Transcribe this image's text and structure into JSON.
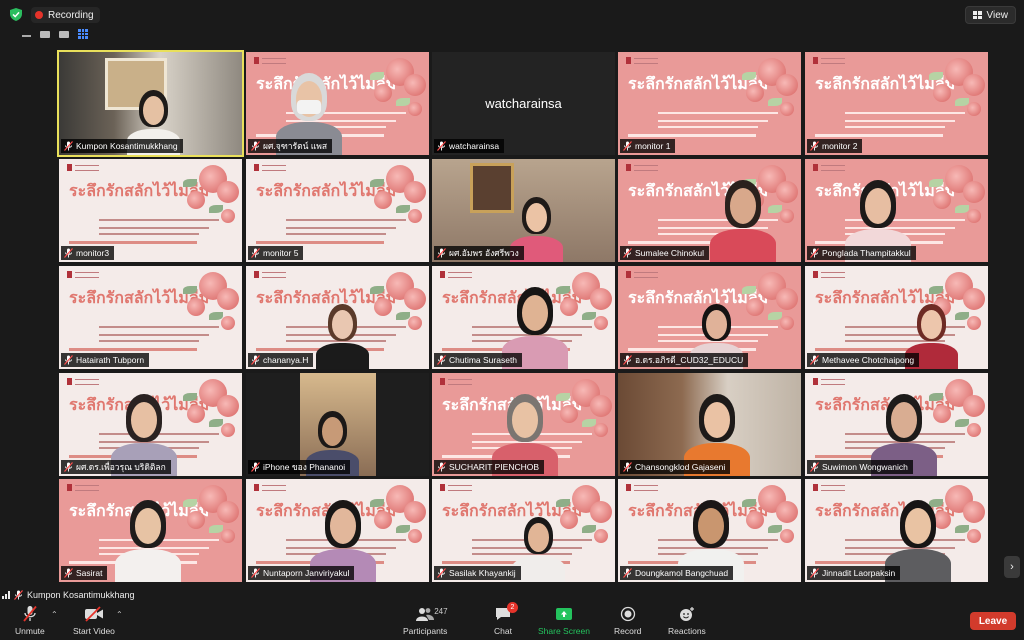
{
  "top": {
    "recording_label": "Recording",
    "view_label": "View"
  },
  "tiles": [
    {
      "name": "Kumpon Kosantimukkhang",
      "type": "camera"
    },
    {
      "name": "ผศ.จุฑารัตน์ แพส",
      "type": "slide-person"
    },
    {
      "name": "watcharainsa",
      "type": "name-only",
      "display_text": "watcharainsa"
    },
    {
      "name": "monitor 1",
      "type": "slide"
    },
    {
      "name": "monitor 2",
      "type": "slide"
    },
    {
      "name": "monitor3",
      "type": "slide"
    },
    {
      "name": "monitor 5",
      "type": "slide"
    },
    {
      "name": "ผศ.อัมพร อังศรีพวง",
      "type": "camera"
    },
    {
      "name": "Sumalee Chinokul",
      "type": "slide-person"
    },
    {
      "name": "Ponglada Thampitakkul",
      "type": "slide-person"
    },
    {
      "name": "Hatairath Tubporn",
      "type": "slide"
    },
    {
      "name": "chananya.H",
      "type": "slide-person"
    },
    {
      "name": "Chutima Suraseth",
      "type": "slide-person"
    },
    {
      "name": "อ.ดร.อภิรดี_CUD32_EDUCU",
      "type": "slide-person"
    },
    {
      "name": "Methavee Chotchaipong",
      "type": "slide-person"
    },
    {
      "name": "ผศ.ดร.เพื่อวรุณ บริดิติลก",
      "type": "slide-person"
    },
    {
      "name": "iPhone ของ Phananoi",
      "type": "camera"
    },
    {
      "name": "SUCHARIT PIENCHOB",
      "type": "slide-person"
    },
    {
      "name": "Chansongklod Gajaseni",
      "type": "camera"
    },
    {
      "name": "Suwimon Wongwanich",
      "type": "slide-person"
    },
    {
      "name": "Sasirat",
      "type": "slide-person"
    },
    {
      "name": "Nuntaporn Janviriyakul",
      "type": "slide-person"
    },
    {
      "name": "Sasilak Khayankij",
      "type": "slide-person"
    },
    {
      "name": "Doungkamol Bangchuad",
      "type": "slide-person"
    },
    {
      "name": "Jinnadit Laorpaksin",
      "type": "slide-person"
    }
  ],
  "slide": {
    "heading": "ระลึกรักสลักไว้ไม่ลืม"
  },
  "self": {
    "name": "Kumpon Kosantimukkhang"
  },
  "toolbar": {
    "unmute": "Unmute",
    "start_video": "Start Video",
    "participants": "Participants",
    "participants_count": "247",
    "chat": "Chat",
    "chat_badge": "2",
    "share_screen": "Share Screen",
    "record": "Record",
    "reactions": "Reactions",
    "leave": "Leave"
  },
  "colors": {
    "speaker_highlight": "#e9e05b",
    "share_green": "#24c35e",
    "leave_red": "#d23b2c",
    "slide_pink": "#e99a98",
    "slide_light": "#f4ebe9"
  }
}
